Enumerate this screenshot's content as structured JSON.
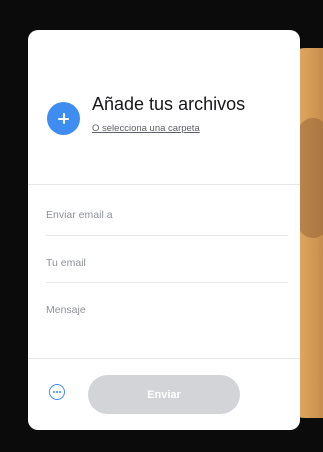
{
  "upload": {
    "title": "Añade tus archivos",
    "folder_link": "O selecciona una carpeta"
  },
  "form": {
    "email_to_placeholder": "Enviar email a",
    "your_email_placeholder": "Tu email",
    "message_placeholder": "Mensaje"
  },
  "footer": {
    "send_label": "Enviar",
    "options_icon": "more-options-icon"
  },
  "colors": {
    "accent": "#3f8df0",
    "send_button_disabled": "#d3d4d8",
    "background": "#0b0b0b",
    "card": "#ffffff"
  }
}
